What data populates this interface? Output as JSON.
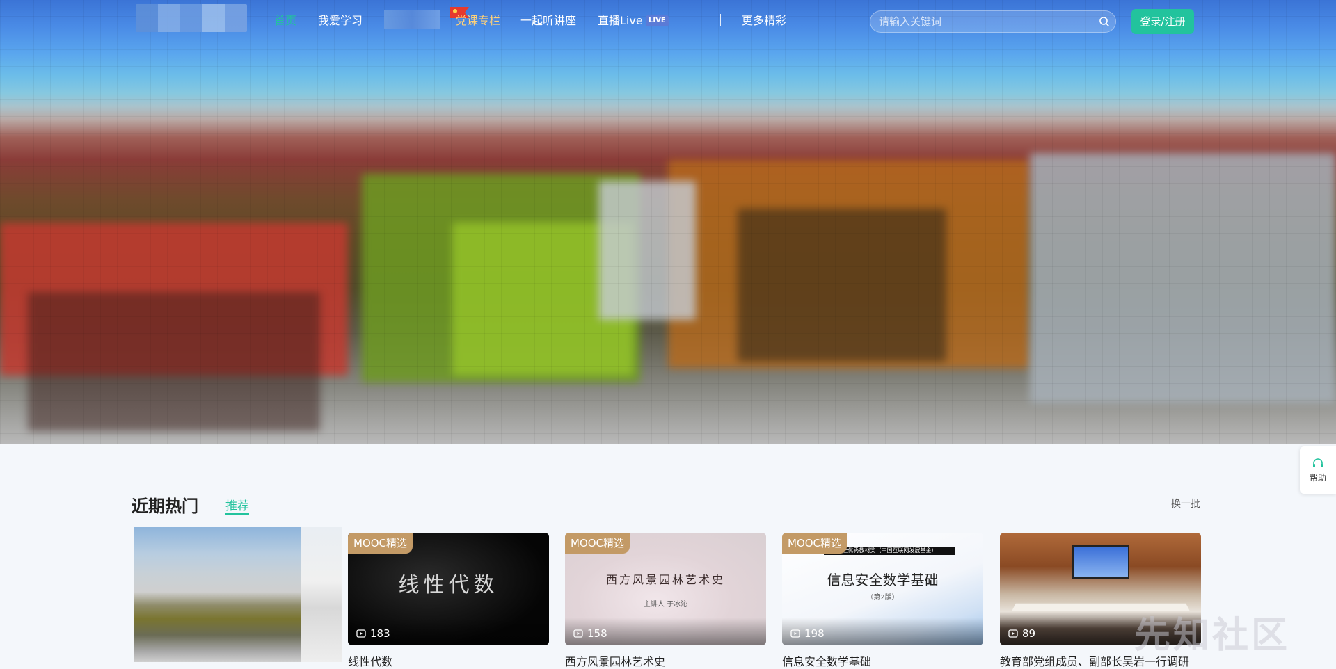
{
  "nav": {
    "items": [
      {
        "label": "首页"
      },
      {
        "label": "我爱学习"
      },
      {
        "label": "党课专栏"
      },
      {
        "label": "一起听讲座"
      },
      {
        "label": "直播Live"
      },
      {
        "label": "更多精彩"
      }
    ],
    "live_badge": "LIVE",
    "search_placeholder": "请输入关键词",
    "login_label": "登录/注册"
  },
  "help": {
    "label": "帮助",
    "icon": "headset-icon"
  },
  "section": {
    "title": "近期热门",
    "tab_label": "推荐",
    "refresh_label": "换一批"
  },
  "featured": {
    "caption": ""
  },
  "courses": [
    {
      "badge": "MOOC精选",
      "thumb_title": "线性代数",
      "plays": "183",
      "name": "线性代数"
    },
    {
      "badge": "MOOC精选",
      "thumb_title": "西方风景园林艺术史",
      "thumb_sub": "主讲人 于冰沁",
      "plays": "158",
      "name": "西方风景园林艺术史"
    },
    {
      "badge": "MOOC精选",
      "thumb_title": "信息安全数学基础",
      "thumb_sub": "（第2版）",
      "thumb_top": "全优秀教材奖（中国互联网发展基金）",
      "plays": "198",
      "name": "信息安全数学基础"
    },
    {
      "badge": "",
      "thumb_title": "",
      "plays": "89",
      "name": "教育部党组成员、副部长吴岩一行调研"
    }
  ],
  "watermark": "先知社区",
  "colors": {
    "accent": "#22c39d",
    "badge": "#c39a66",
    "party": "#ffd27a"
  }
}
